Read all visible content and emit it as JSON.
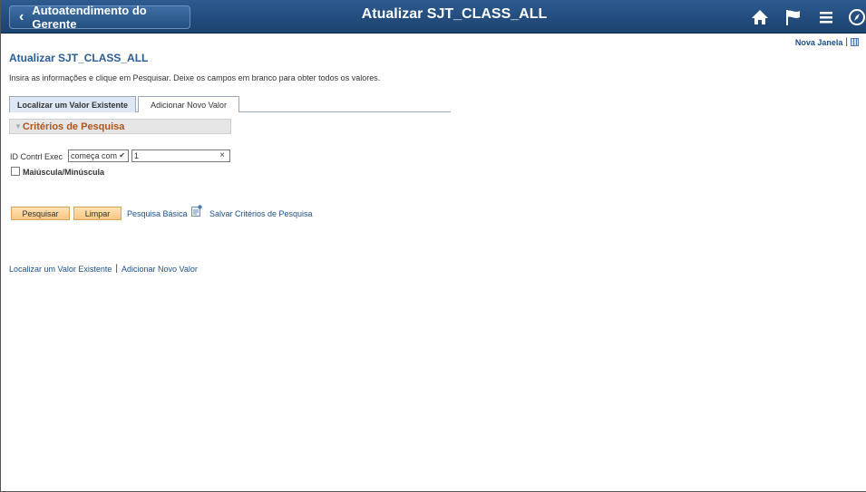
{
  "header": {
    "back_label": "Autoatendimento do Gerente",
    "title": "Atualizar SJT_CLASS_ALL",
    "icons": [
      "home-icon",
      "flag-icon",
      "menu-icon",
      "navbar-icon"
    ]
  },
  "top_links": {
    "new_window": "Nova Janela"
  },
  "page": {
    "title": "Atualizar SJT_CLASS_ALL",
    "instructions": "Insira as informações e clique em Pesquisar. Deixe os campos em branco para obter todos os valores."
  },
  "tabs": [
    {
      "label": "Localizar um Valor Existente",
      "active": true
    },
    {
      "label": "Adicionar Novo Valor",
      "active": false
    }
  ],
  "criteria": {
    "header": "Critérios de Pesquisa",
    "field_label": "ID Contrl Exec",
    "operator": "começa com",
    "value": "1",
    "case_label": "Maiúscula/Minúscula",
    "case_checked": false
  },
  "actions": {
    "search": "Pesquisar",
    "clear": "Limpar",
    "basic_search": "Pesquisa Básica",
    "save_criteria": "Salvar Critérios de Pesquisa"
  },
  "bottom_links": {
    "find_existing": "Localizar um Valor Existente",
    "add_new": "Adicionar Novo Valor"
  },
  "colors": {
    "header_bg": "#1c426f",
    "title_blue": "#2a5c95",
    "link_blue": "#1c4f8a",
    "criteria_orange": "#b0541a",
    "button_orange": "#f6c785"
  }
}
